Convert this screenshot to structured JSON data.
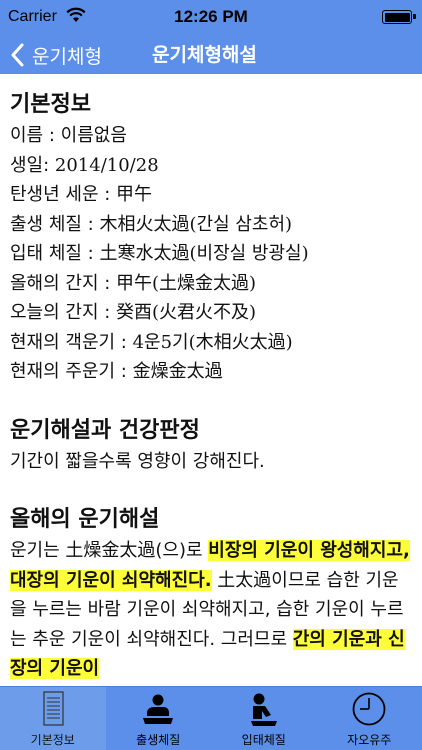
{
  "status": {
    "carrier": "Carrier",
    "time": "12:26 PM"
  },
  "nav": {
    "back_label": "운기체형",
    "title": "운기체형해설"
  },
  "basic": {
    "title": "기본정보",
    "rows": [
      {
        "label": "이름 : ",
        "value": "이름없음"
      },
      {
        "label": "생일: ",
        "value": "2014/10/28"
      },
      {
        "label": "탄생년 세운 : ",
        "value": "甲午"
      },
      {
        "label": "출생 체질 : ",
        "value": "木相火太過(간실 삼초허)"
      },
      {
        "label": "입태 체질 : ",
        "value": "土寒水太過(비장실 방광실)"
      },
      {
        "label": "올해의 간지 : ",
        "value": "甲午(土燥金太過)"
      },
      {
        "label": "오늘의 간지 : ",
        "value": "癸酉(火君火不及)"
      },
      {
        "label": "현재의 객운기 : ",
        "value": "4운5기(木相火太過)"
      },
      {
        "label": "현재의 주운기 : ",
        "value": "金燥金太過"
      }
    ]
  },
  "health": {
    "title": "운기해설과 건강판정",
    "text": "기간이 짧을수록 영향이 강해진다."
  },
  "year": {
    "title": "올해의 운기해설",
    "p1": "운기는 土燥金太過(으)로 ",
    "h1": "비장의 기운이 왕성해지고, 대장의 기운이 쇠약해진다.",
    "p2": " 土太過이므로 습한 기운을 누르는 바람 기운이 쇠약해지고, 습한 기운이 누르는 추운 기운이 쇠약해진다. 그러므로 ",
    "h2": "간의 기운과 신장의 기운이"
  },
  "tabs": [
    {
      "label": "기본정보",
      "icon": "document-icon",
      "active": true
    },
    {
      "label": "출생체질",
      "icon": "baby-icon",
      "active": false
    },
    {
      "label": "입태체질",
      "icon": "fetus-icon",
      "active": false
    },
    {
      "label": "자오유주",
      "icon": "clock-icon",
      "active": false
    }
  ],
  "colors": {
    "bar": "#5b8fe9",
    "highlight": "#fdfd3a"
  }
}
